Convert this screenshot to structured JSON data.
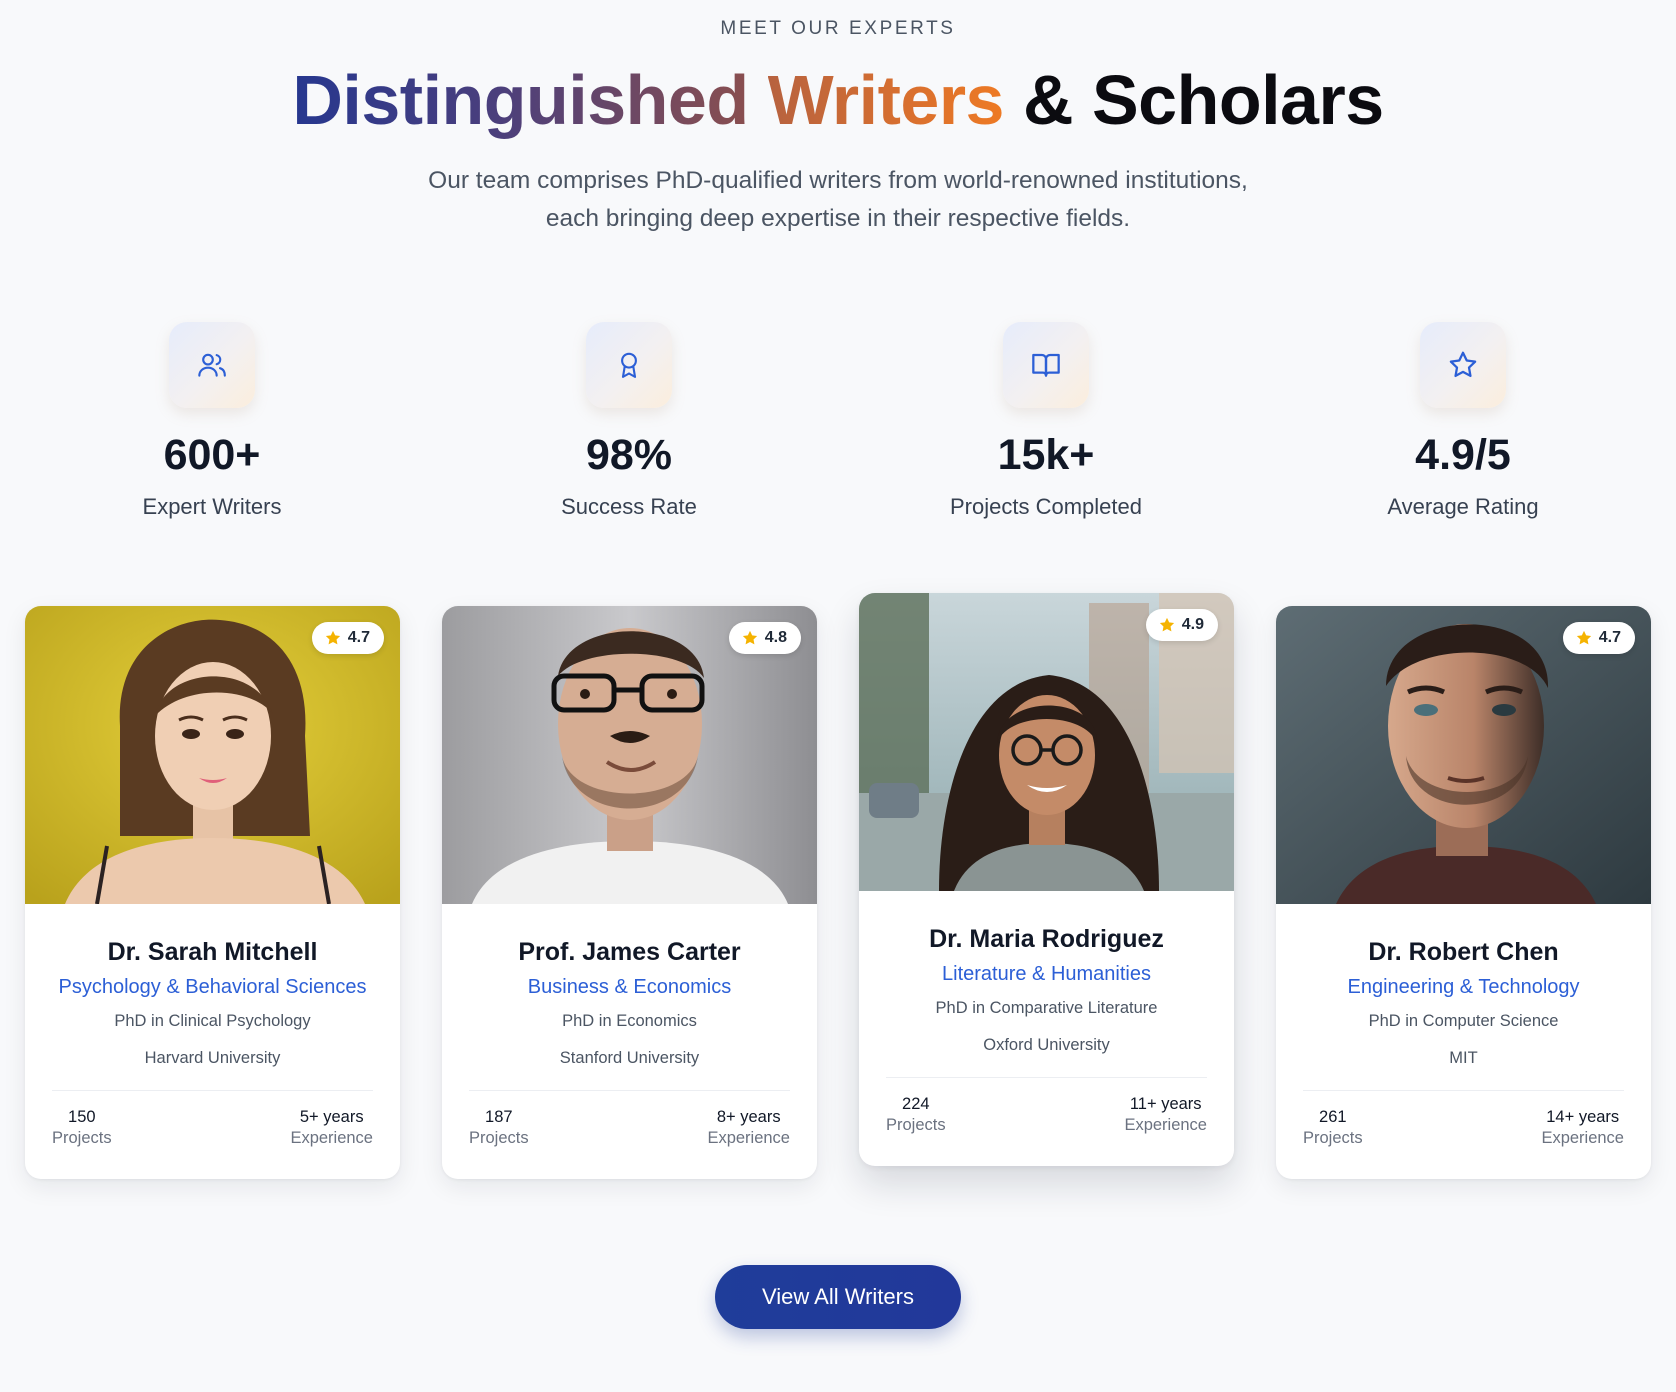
{
  "header": {
    "eyebrow": "MEET OUR EXPERTS",
    "title_part1": "Distinguished",
    "title_part2": "Writers",
    "title_part3": "& Scholars",
    "subtitle_line1": "Our team comprises PhD-qualified writers from world-renowned institutions,",
    "subtitle_line2": "each bringing deep expertise in their respective fields."
  },
  "stats": [
    {
      "icon": "users-icon",
      "value": "600+",
      "label": "Expert Writers"
    },
    {
      "icon": "award-icon",
      "value": "98%",
      "label": "Success Rate"
    },
    {
      "icon": "book-open-icon",
      "value": "15k+",
      "label": "Projects Completed"
    },
    {
      "icon": "star-icon",
      "value": "4.9/5",
      "label": "Average Rating"
    }
  ],
  "writers": [
    {
      "name": "Dr. Sarah Mitchell",
      "field": "Psychology & Behavioral Sciences",
      "degree": "PhD in Clinical Psychology",
      "university": "Harvard University",
      "rating": "4.7",
      "projects_value": "150",
      "projects_label": "Projects",
      "experience_value": "5+ years",
      "experience_label": "Experience"
    },
    {
      "name": "Prof. James Carter",
      "field": "Business & Economics",
      "degree": "PhD in Economics",
      "university": "Stanford University",
      "rating": "4.8",
      "projects_value": "187",
      "projects_label": "Projects",
      "experience_value": "8+ years",
      "experience_label": "Experience"
    },
    {
      "name": "Dr. Maria Rodriguez",
      "field": "Literature & Humanities",
      "degree": "PhD in Comparative Literature",
      "university": "Oxford University",
      "rating": "4.9",
      "projects_value": "224",
      "projects_label": "Projects",
      "experience_value": "11+ years",
      "experience_label": "Experience"
    },
    {
      "name": "Dr. Robert Chen",
      "field": "Engineering & Technology",
      "degree": "PhD in Computer Science",
      "university": "MIT",
      "rating": "4.7",
      "projects_value": "261",
      "projects_label": "Projects",
      "experience_value": "14+ years",
      "experience_label": "Experience"
    }
  ],
  "cta": {
    "label": "View All Writers"
  },
  "colors": {
    "accent_blue": "#2c5fd6",
    "button_blue": "#1f3d9a",
    "star_yellow": "#f5b301",
    "title_orange": "#e2722c"
  }
}
